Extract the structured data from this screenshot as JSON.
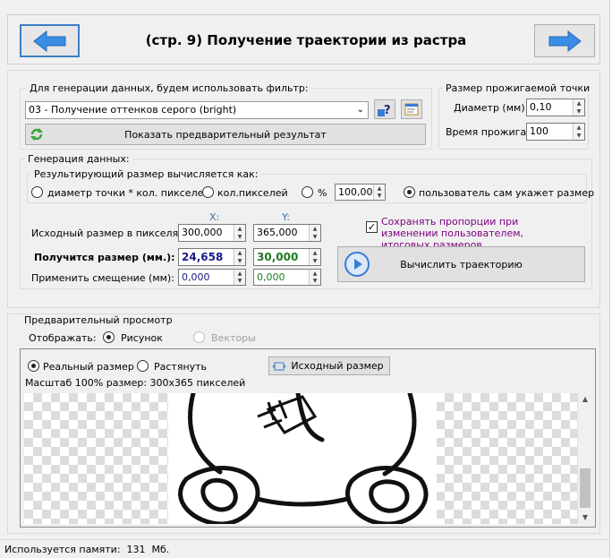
{
  "header": {
    "title": "(стр. 9) Получение траектории из растра",
    "back_icon": "arrow-left-icon",
    "next_icon": "arrow-right-icon",
    "arrow_color": "#3a8ee6"
  },
  "filter_group": {
    "label": "Для генерации данных, будем использовать фильтр:",
    "selected_filter": "03 - Получение оттенков серого (bright)",
    "preview_button": "Показать предварительный результат"
  },
  "dot_group": {
    "label": "Размер прожигаемой точки",
    "diameter_label": "Диаметр (мм):",
    "diameter_value": "0,10",
    "burn_time_label": "Время прожига:",
    "burn_time_value": "100"
  },
  "generation_group": {
    "label": "Генерация данных:",
    "result_size_label": "Результирующий размер вычисляется как:",
    "radio_options": [
      "диаметр точки * кол. пикселей",
      "кол.пикселей",
      "%",
      "пользователь сам укажет размер"
    ],
    "selected_option": "пользователь сам укажет размер",
    "percent_value": "100,00",
    "x_header": "X:",
    "y_header": "Y:",
    "source_size_label": "Исходный размер в пикселях:",
    "source_x": "300,000",
    "source_y": "365,000",
    "result_size_label2": "Получится размер (мм.):",
    "result_x": "24,658",
    "result_y": "30,000",
    "offset_label": "Применить смещение (мм):",
    "offset_x": "0,000",
    "offset_y": "0,000",
    "keep_proportions_label": "Сохранять пропорции при изменении пользователем, итоговых размеров",
    "keep_proportions_checked": true,
    "compute_button": "Вычислить траекторию",
    "result_x_color": "#1a1a8c",
    "result_y_color": "#1f7a1f",
    "accent_purple": "#800080"
  },
  "preview_group": {
    "label": "Предварительный просмотр",
    "display_label": "Отображать:",
    "display_options": [
      "Рисунок",
      "Векторы"
    ],
    "display_selected": "Рисунок",
    "size_options": [
      "Реальный размер",
      "Растянуть"
    ],
    "size_selected": "Реальный размер",
    "original_size_button": "Исходный размер",
    "scale_text": "Масштаб 100% размер: 300x365 пикселей"
  },
  "status_bar": {
    "memory_text": "Используется памяти:  131  Мб."
  }
}
